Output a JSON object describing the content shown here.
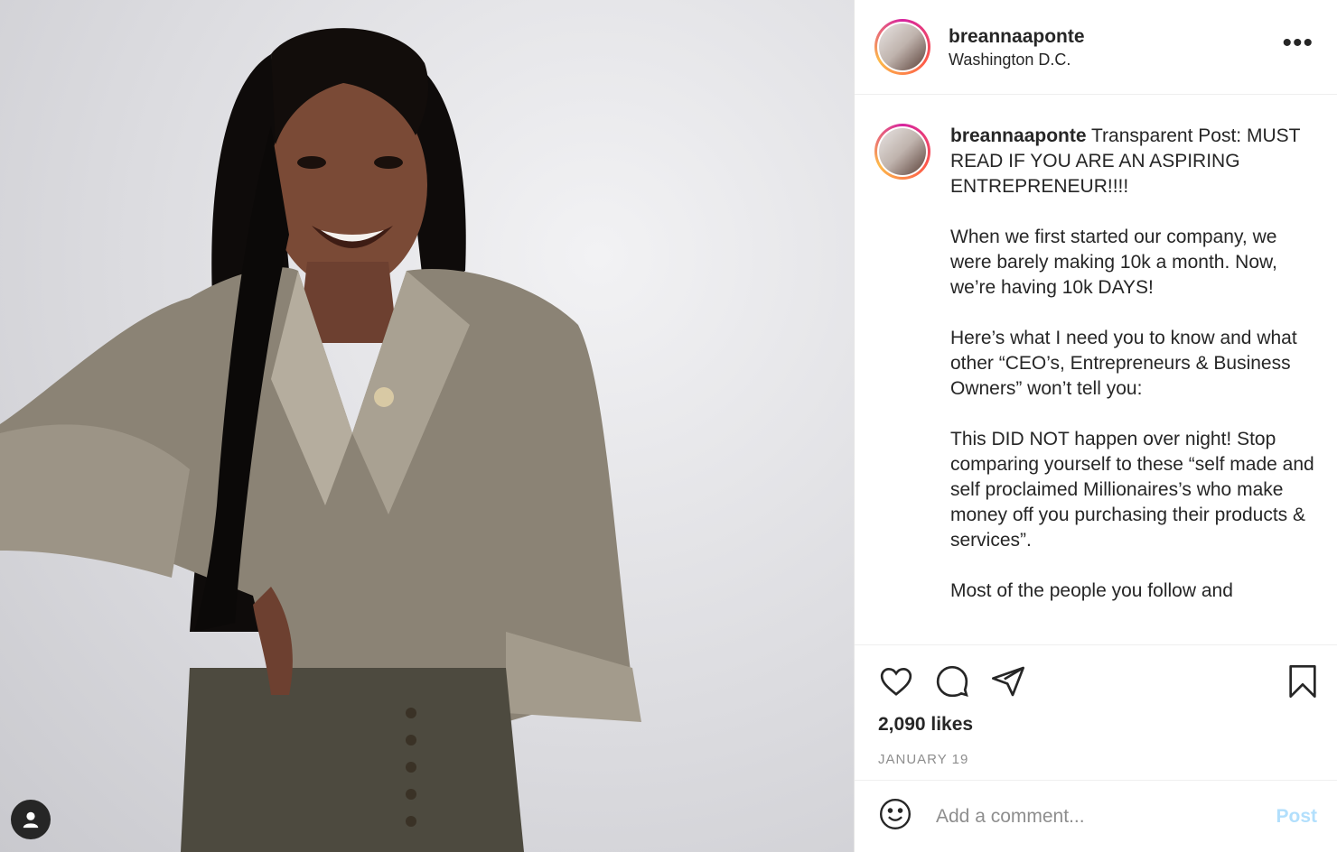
{
  "header": {
    "username": "breannaaponte",
    "location": "Washington D.C.",
    "more_icon": "more-horizontal-icon"
  },
  "caption": {
    "username": "breannaaponte",
    "text": " Transparent Post: MUST READ IF YOU ARE AN ASPIRING ENTREPRENEUR!!!!\n\nWhen we first started our company, we were barely making 10k a month. Now, we’re having 10k DAYS!\n\nHere’s what I need you to know and what other “CEO’s, Entrepreneurs & Business Owners” won’t tell you:\n\nThis DID NOT happen over night! Stop comparing yourself to these “self made and self proclaimed Millionaires’s who make money off you purchasing their products & services”.\n\nMost of the people you follow and"
  },
  "actions": {
    "icons": [
      "heart-icon",
      "comment-icon",
      "share-icon",
      "bookmark-icon"
    ],
    "likes": "2,090 likes",
    "date": "JANUARY 19"
  },
  "comment": {
    "placeholder": "Add a comment...",
    "post_label": "Post",
    "emoji_icon": "smiley-icon"
  },
  "media": {
    "tag_icon": "user-tag-icon"
  },
  "colors": {
    "text": "#262626",
    "muted": "#8e8e8e",
    "post_button": "#b2dffc"
  }
}
